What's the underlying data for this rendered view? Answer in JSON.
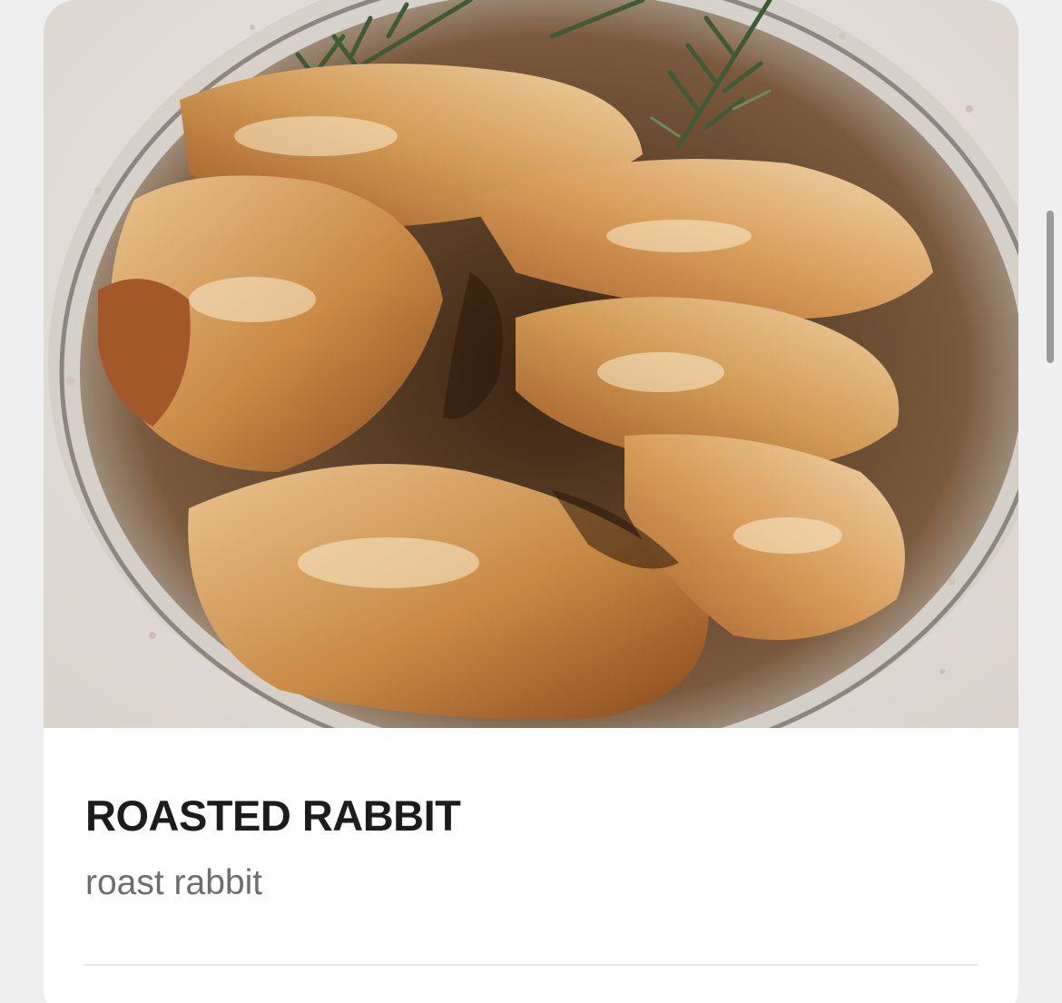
{
  "card": {
    "image": {
      "alt": "roasted rabbit in a glass bowl with rosemary",
      "icon": "food-photo"
    },
    "title": "ROASTED RABBIT",
    "subtitle": "roast rabbit"
  },
  "colors": {
    "background": "#efefef",
    "card": "#ffffff",
    "title": "#1c1c1c",
    "subtitle": "#6e6e6e",
    "divider": "#e6e6e6",
    "scrollbar": "#9a9a9a"
  }
}
